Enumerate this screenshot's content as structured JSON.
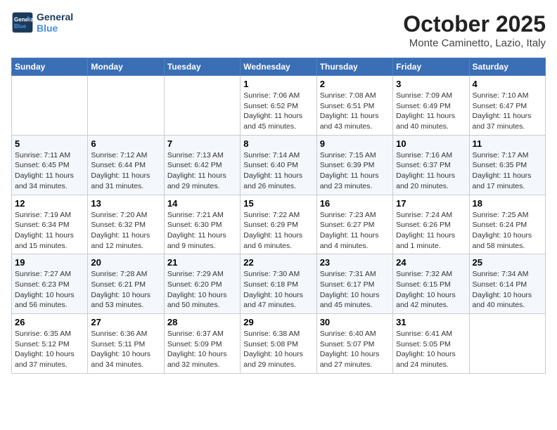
{
  "header": {
    "logo_line1": "General",
    "logo_line2": "Blue",
    "month": "October 2025",
    "location": "Monte Caminetto, Lazio, Italy"
  },
  "days_of_week": [
    "Sunday",
    "Monday",
    "Tuesday",
    "Wednesday",
    "Thursday",
    "Friday",
    "Saturday"
  ],
  "weeks": [
    [
      {
        "day": "",
        "info": ""
      },
      {
        "day": "",
        "info": ""
      },
      {
        "day": "",
        "info": ""
      },
      {
        "day": "1",
        "info": "Sunrise: 7:06 AM\nSunset: 6:52 PM\nDaylight: 11 hours and 45 minutes."
      },
      {
        "day": "2",
        "info": "Sunrise: 7:08 AM\nSunset: 6:51 PM\nDaylight: 11 hours and 43 minutes."
      },
      {
        "day": "3",
        "info": "Sunrise: 7:09 AM\nSunset: 6:49 PM\nDaylight: 11 hours and 40 minutes."
      },
      {
        "day": "4",
        "info": "Sunrise: 7:10 AM\nSunset: 6:47 PM\nDaylight: 11 hours and 37 minutes."
      }
    ],
    [
      {
        "day": "5",
        "info": "Sunrise: 7:11 AM\nSunset: 6:45 PM\nDaylight: 11 hours and 34 minutes."
      },
      {
        "day": "6",
        "info": "Sunrise: 7:12 AM\nSunset: 6:44 PM\nDaylight: 11 hours and 31 minutes."
      },
      {
        "day": "7",
        "info": "Sunrise: 7:13 AM\nSunset: 6:42 PM\nDaylight: 11 hours and 29 minutes."
      },
      {
        "day": "8",
        "info": "Sunrise: 7:14 AM\nSunset: 6:40 PM\nDaylight: 11 hours and 26 minutes."
      },
      {
        "day": "9",
        "info": "Sunrise: 7:15 AM\nSunset: 6:39 PM\nDaylight: 11 hours and 23 minutes."
      },
      {
        "day": "10",
        "info": "Sunrise: 7:16 AM\nSunset: 6:37 PM\nDaylight: 11 hours and 20 minutes."
      },
      {
        "day": "11",
        "info": "Sunrise: 7:17 AM\nSunset: 6:35 PM\nDaylight: 11 hours and 17 minutes."
      }
    ],
    [
      {
        "day": "12",
        "info": "Sunrise: 7:19 AM\nSunset: 6:34 PM\nDaylight: 11 hours and 15 minutes."
      },
      {
        "day": "13",
        "info": "Sunrise: 7:20 AM\nSunset: 6:32 PM\nDaylight: 11 hours and 12 minutes."
      },
      {
        "day": "14",
        "info": "Sunrise: 7:21 AM\nSunset: 6:30 PM\nDaylight: 11 hours and 9 minutes."
      },
      {
        "day": "15",
        "info": "Sunrise: 7:22 AM\nSunset: 6:29 PM\nDaylight: 11 hours and 6 minutes."
      },
      {
        "day": "16",
        "info": "Sunrise: 7:23 AM\nSunset: 6:27 PM\nDaylight: 11 hours and 4 minutes."
      },
      {
        "day": "17",
        "info": "Sunrise: 7:24 AM\nSunset: 6:26 PM\nDaylight: 11 hours and 1 minute."
      },
      {
        "day": "18",
        "info": "Sunrise: 7:25 AM\nSunset: 6:24 PM\nDaylight: 10 hours and 58 minutes."
      }
    ],
    [
      {
        "day": "19",
        "info": "Sunrise: 7:27 AM\nSunset: 6:23 PM\nDaylight: 10 hours and 56 minutes."
      },
      {
        "day": "20",
        "info": "Sunrise: 7:28 AM\nSunset: 6:21 PM\nDaylight: 10 hours and 53 minutes."
      },
      {
        "day": "21",
        "info": "Sunrise: 7:29 AM\nSunset: 6:20 PM\nDaylight: 10 hours and 50 minutes."
      },
      {
        "day": "22",
        "info": "Sunrise: 7:30 AM\nSunset: 6:18 PM\nDaylight: 10 hours and 47 minutes."
      },
      {
        "day": "23",
        "info": "Sunrise: 7:31 AM\nSunset: 6:17 PM\nDaylight: 10 hours and 45 minutes."
      },
      {
        "day": "24",
        "info": "Sunrise: 7:32 AM\nSunset: 6:15 PM\nDaylight: 10 hours and 42 minutes."
      },
      {
        "day": "25",
        "info": "Sunrise: 7:34 AM\nSunset: 6:14 PM\nDaylight: 10 hours and 40 minutes."
      }
    ],
    [
      {
        "day": "26",
        "info": "Sunrise: 6:35 AM\nSunset: 5:12 PM\nDaylight: 10 hours and 37 minutes."
      },
      {
        "day": "27",
        "info": "Sunrise: 6:36 AM\nSunset: 5:11 PM\nDaylight: 10 hours and 34 minutes."
      },
      {
        "day": "28",
        "info": "Sunrise: 6:37 AM\nSunset: 5:09 PM\nDaylight: 10 hours and 32 minutes."
      },
      {
        "day": "29",
        "info": "Sunrise: 6:38 AM\nSunset: 5:08 PM\nDaylight: 10 hours and 29 minutes."
      },
      {
        "day": "30",
        "info": "Sunrise: 6:40 AM\nSunset: 5:07 PM\nDaylight: 10 hours and 27 minutes."
      },
      {
        "day": "31",
        "info": "Sunrise: 6:41 AM\nSunset: 5:05 PM\nDaylight: 10 hours and 24 minutes."
      },
      {
        "day": "",
        "info": ""
      }
    ]
  ]
}
